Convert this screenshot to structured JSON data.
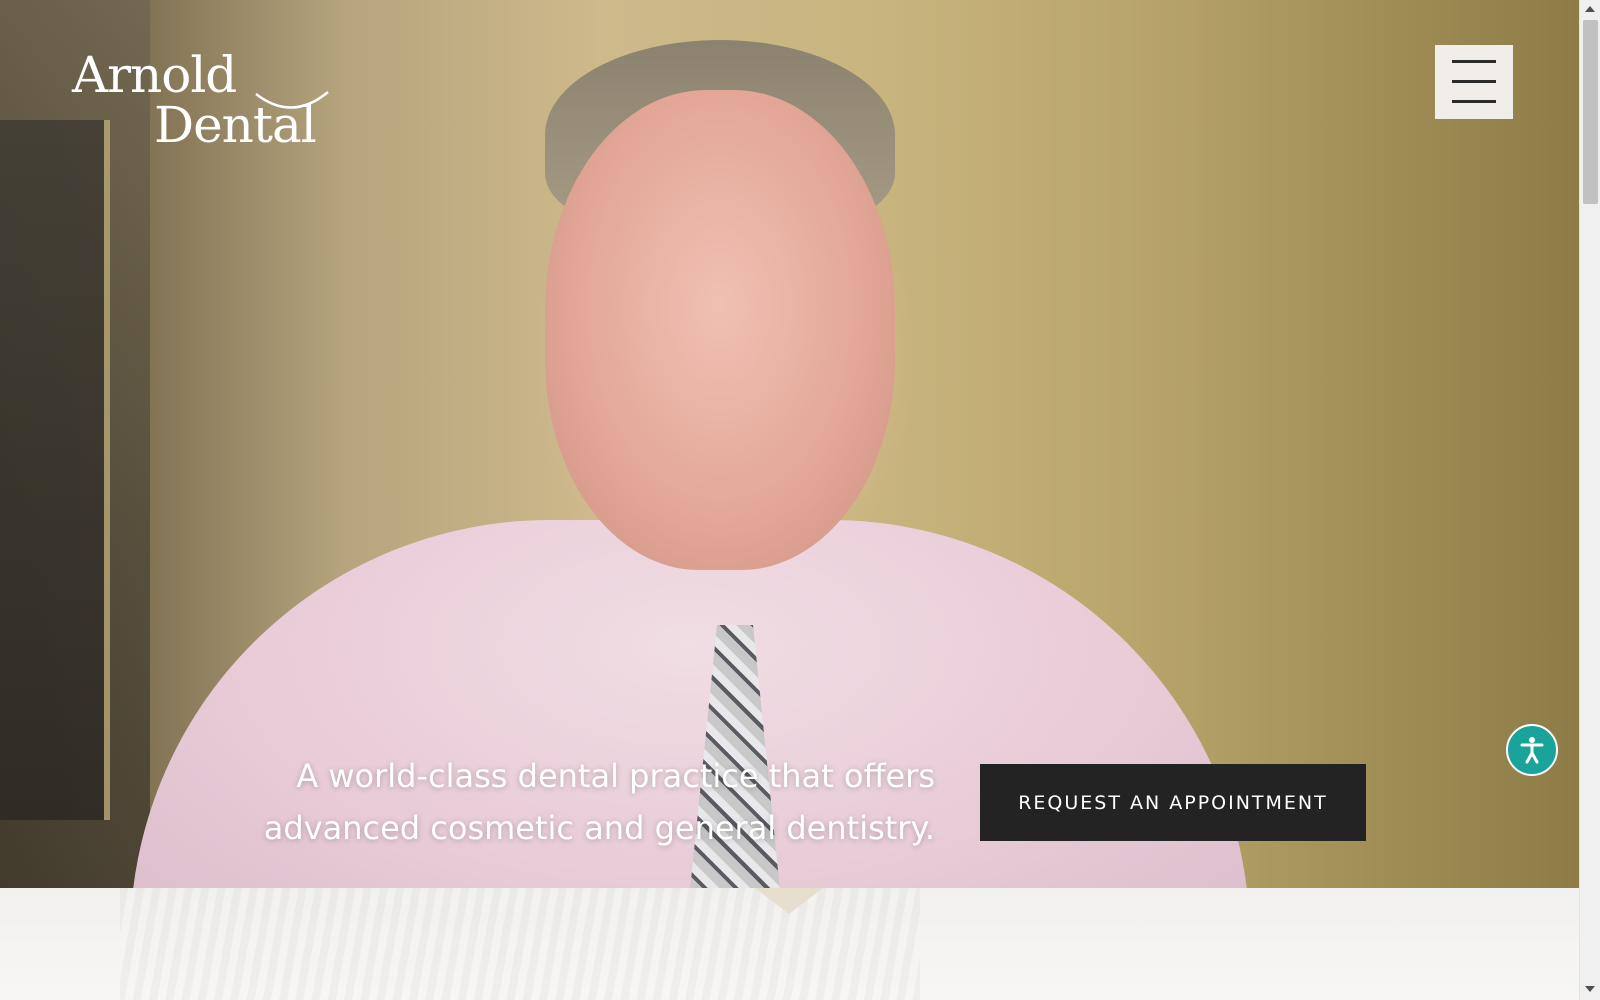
{
  "logo": {
    "line1": "Arnold",
    "line2": "Dental",
    "icon": "smile-arc"
  },
  "header": {
    "menu_icon": "hamburger-menu-icon"
  },
  "hero": {
    "tagline_line1": "A world-class dental practice that offers",
    "tagline_line2": "advanced cosmetic and general dentistry.",
    "cta_label": "REQUEST AN APPOINTMENT"
  },
  "widgets": {
    "accessibility_icon": "accessibility-person-icon",
    "accessibility_color": "#1aa39a"
  },
  "colors": {
    "cta_background": "#232323",
    "menu_background": "#f1ede8",
    "scroll_indicator": "#e6dfcf"
  }
}
